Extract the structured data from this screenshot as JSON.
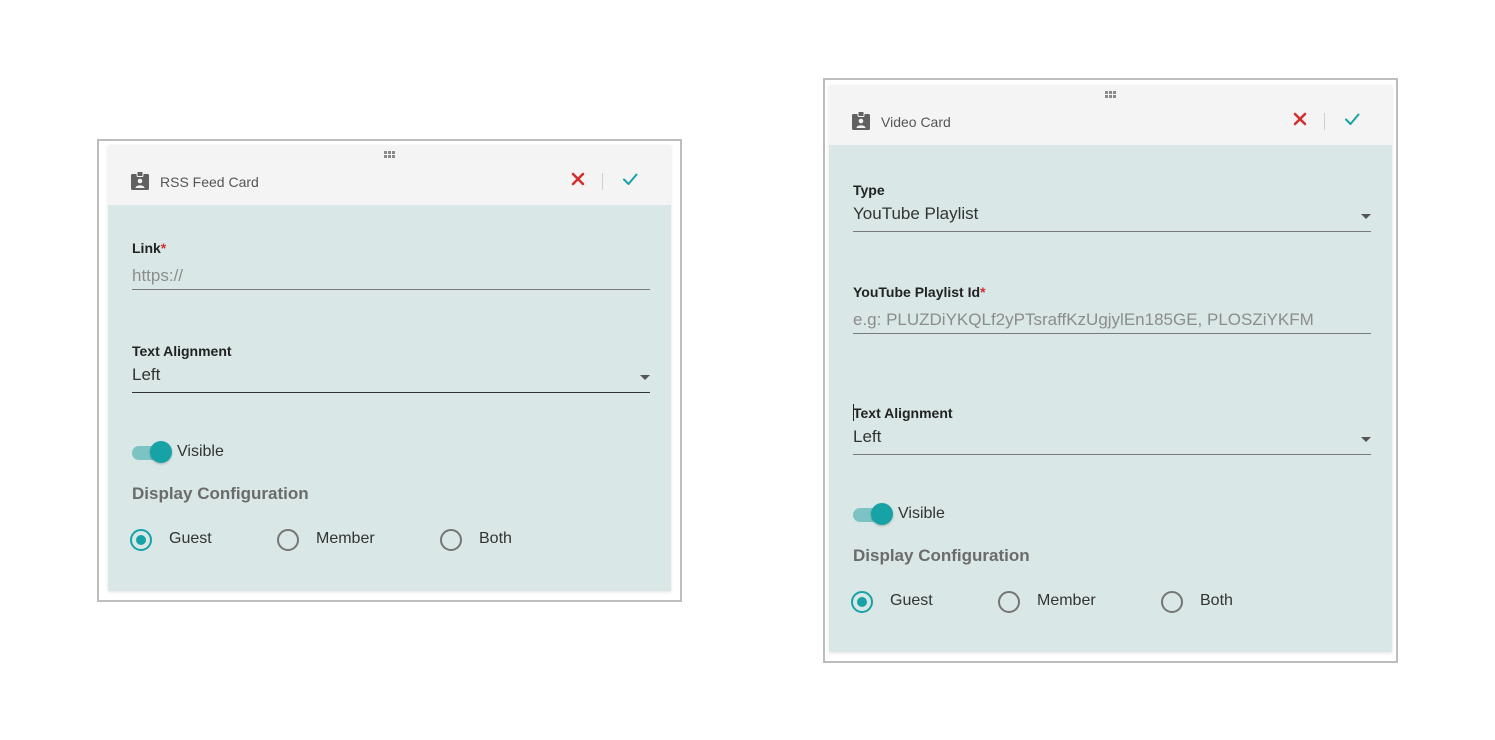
{
  "colors": {
    "card_background": "#d9e8e6",
    "header_background": "#f4f4f4",
    "accent": "#17a2a6",
    "cancel": "#d32f2f",
    "confirm": "#17a2a6"
  },
  "rss_card": {
    "title": "RSS Feed Card",
    "icon": "badge-icon",
    "cancel_icon": "close-icon",
    "confirm_icon": "check-icon",
    "link": {
      "label": "Link",
      "required_mark": "*",
      "placeholder": "https://",
      "value": ""
    },
    "text_alignment": {
      "label": "Text Alignment",
      "value": "Left"
    },
    "visible": {
      "label": "Visible",
      "on": true
    },
    "display_configuration": {
      "title": "Display Configuration",
      "options": [
        "Guest",
        "Member",
        "Both"
      ],
      "selected": "Guest"
    }
  },
  "video_card": {
    "title": "Video Card",
    "icon": "badge-icon",
    "cancel_icon": "close-icon",
    "confirm_icon": "check-icon",
    "type": {
      "label": "Type",
      "value": "YouTube Playlist"
    },
    "playlist_id": {
      "label": "YouTube Playlist Id",
      "required_mark": "*",
      "placeholder": "e.g: PLUZDiYKQLf2yPTsraffKzUgjylEn185GE, PLOSZiYKFM",
      "value": ""
    },
    "text_alignment": {
      "label": "Text Alignment",
      "value": "Left"
    },
    "visible": {
      "label": "Visible",
      "on": true
    },
    "display_configuration": {
      "title": "Display Configuration",
      "options": [
        "Guest",
        "Member",
        "Both"
      ],
      "selected": "Guest"
    }
  }
}
